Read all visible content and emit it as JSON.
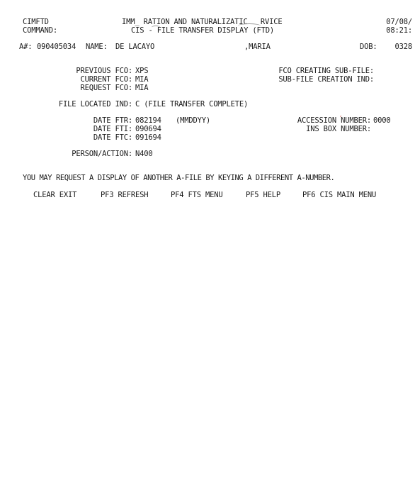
{
  "header": {
    "program": "CIMFTD",
    "command_label": "COMMAND:",
    "agency_title": "IMM_ RATION AND NATURALIZATIC   RVICE",
    "screen_title": "CIS - FILE TRANSFER DISPLAY (FTD)",
    "date": "07/08/",
    "time": "08:21:"
  },
  "subject": {
    "anum_label": "A#:",
    "anum_value": "090405034",
    "name_label": "NAME:",
    "last_name": "DE LACAYO",
    "first_name": ",MARIA",
    "dob_label": "DOB:",
    "dob_value": "0328"
  },
  "fco": {
    "previous_label": "PREVIOUS FCO:",
    "previous_value": "XPS",
    "current_label": "CURRENT FCO:",
    "current_value": "MIA",
    "request_label": "REQUEST FCO:",
    "request_value": "MIA",
    "creating_sub_label": "FCO CREATING SUB-FILE:",
    "sub_creation_label": "SUB-FILE CREATION IND:"
  },
  "file_located": {
    "label": "FILE LOCATED IND:",
    "value": "C (FILE TRANSFER COMPLETE)"
  },
  "dates": {
    "ftr_label": "DATE FTR:",
    "ftr_value": "082194",
    "format_hint": "(MMDDYY)",
    "fti_label": "DATE FTI:",
    "fti_value": "090694",
    "ftc_label": "DATE FTC:",
    "ftc_value": "091694",
    "accession_label": "ACCESSION NUMBER:",
    "accession_value": "0000",
    "ins_box_label": "INS BOX NUMBER:"
  },
  "person_action": {
    "label": "PERSON/ACTION:",
    "value": "N400"
  },
  "message": "YOU MAY REQUEST A DISPLAY OF ANOTHER A-FILE BY KEYING A DIFFERENT A-NUMBER.",
  "function_keys": [
    "CLEAR EXIT",
    "PF3 REFRESH",
    "PF4 FTS MENU",
    "PF5 HELP",
    "PF6 CIS MAIN MENU"
  ],
  "colors": {
    "text": "#1a1a1a",
    "background": "#ffffff",
    "pen_mark": "#c0392b"
  }
}
